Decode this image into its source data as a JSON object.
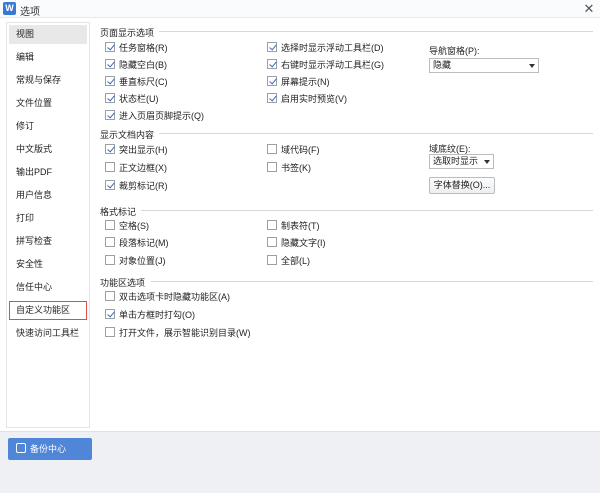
{
  "window": {
    "title": "选项",
    "app_icon": "W"
  },
  "sidebar": {
    "items": [
      {
        "label": "视图",
        "selected": true
      },
      {
        "label": "编辑"
      },
      {
        "label": "常规与保存"
      },
      {
        "label": "文件位置"
      },
      {
        "label": "修订"
      },
      {
        "label": "中文版式"
      },
      {
        "label": "输出PDF"
      },
      {
        "label": "用户信息"
      },
      {
        "label": "打印"
      },
      {
        "label": "拼写检查"
      },
      {
        "label": "安全性"
      },
      {
        "label": "信任中心"
      },
      {
        "label": "自定义功能区",
        "highlighted": true
      },
      {
        "label": "快速访问工具栏"
      }
    ],
    "backup_label": "备份中心"
  },
  "page_display": {
    "title": "页面显示选项",
    "col1": [
      {
        "label": "任务窗格(R)",
        "checked": true
      },
      {
        "label": "隐藏空白(B)",
        "checked": true
      },
      {
        "label": "垂直标尺(C)",
        "checked": true
      },
      {
        "label": "状态栏(U)",
        "checked": true
      },
      {
        "label": "进入页眉页脚提示(Q)",
        "checked": true
      }
    ],
    "col2": [
      {
        "label": "选择时显示浮动工具栏(D)",
        "checked": true
      },
      {
        "label": "右键时显示浮动工具栏(G)",
        "checked": true
      },
      {
        "label": "屏幕提示(N)",
        "checked": true
      },
      {
        "label": "启用实时预览(V)",
        "checked": true
      }
    ],
    "nav_pane_label": "导航窗格(P):",
    "nav_pane_value": "隐藏"
  },
  "doc_content": {
    "title": "显示文档内容",
    "col1": [
      {
        "label": "突出显示(H)",
        "checked": true
      },
      {
        "label": "正文边框(X)",
        "checked": false
      },
      {
        "label": "裁剪标记(R)",
        "checked": true
      }
    ],
    "col2": [
      {
        "label": "域代码(F)",
        "checked": false
      },
      {
        "label": "书签(K)",
        "checked": false
      }
    ],
    "field_shading_label": "域底纹(E):",
    "field_shading_value": "选取时显示",
    "font_replace_label": "字体替换(O)..."
  },
  "format_marks": {
    "title": "格式标记",
    "col1": [
      {
        "label": "空格(S)",
        "checked": false
      },
      {
        "label": "段落标记(M)",
        "checked": false
      },
      {
        "label": "对象位置(J)",
        "checked": false
      }
    ],
    "col2": [
      {
        "label": "制表符(T)",
        "checked": false
      },
      {
        "label": "隐藏文字(I)",
        "checked": false
      },
      {
        "label": "全部(L)",
        "checked": false
      }
    ]
  },
  "ribbon": {
    "title": "功能区选项",
    "items": [
      {
        "label": "双击选项卡时隐藏功能区(A)",
        "checked": false
      },
      {
        "label": "单击方框时打勾(O)",
        "checked": true
      },
      {
        "label": "打开文件，展示智能识别目录(W)",
        "checked": false
      }
    ]
  },
  "colors": {
    "accent": "#4f86d8",
    "highlight_border": "#e34a4a",
    "check": "#3b68b8"
  }
}
